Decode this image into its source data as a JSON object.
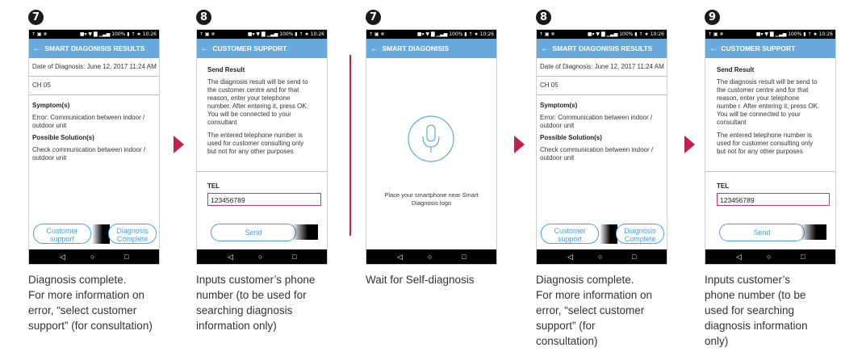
{
  "status": {
    "left": "↑ ▣ ✵",
    "right": "■▾ ▼ ▇ ▁▃▅ 100% ▮ ↑ ★ 10:26"
  },
  "nav": {
    "back": "◁",
    "home": "○",
    "recent": "□"
  },
  "accent": "#c41e4b",
  "screens": [
    {
      "step": "7",
      "title": "SMART DIAGONISIS RESULTS",
      "date": "Date of Diagnosis: June 12, 2017 11:24 AM",
      "code": "CH 05",
      "symptom_heading": "Symptom(s)",
      "symptom_text": "Error: Communication between indoor / outdoor unit",
      "solution_heading": "Possible Solution(s)",
      "solution_text": "Check communication between indoor / outdoor unit",
      "btn_customer_1": "Customer",
      "btn_customer_2": "support",
      "btn_diag_1": "Diagnosis",
      "btn_diag_2": "Complete",
      "caption": [
        "Diagnosis complete.",
        "For more information on",
        "error, “select customer",
        "support” (for consultation)"
      ]
    },
    {
      "step": "8",
      "title": "CUSTOMER SUPPORT",
      "send_heading": "Send Result",
      "p1": [
        "The diagnosis result will be send to",
        "the customer centre and for that",
        "reason, enter your telephone",
        "number. After entering it, press OK.",
        "You will be connected to your",
        "consultant"
      ],
      "p2": [
        "The entered telephone number is",
        "used for customer consulting only",
        "but not for any other purposes"
      ],
      "tel_label": "TEL",
      "tel_value": "123456789",
      "send_button": "Send",
      "caption": [
        "Inputs customer’s phone",
        "number (to be used for",
        "searching diagnosis",
        "information only)"
      ]
    },
    {
      "step": "7",
      "title": "SMART DIAGONISIS",
      "instruction": [
        "Place your smartphone near Smart",
        "Diagnosis logo"
      ],
      "caption": [
        "Wait for Self-diagnosis"
      ]
    },
    {
      "step": "8",
      "title": "SMART DIAGONISIS RESULTS",
      "date": "Date of Diagnosis: June 12, 2017 11:24 AM",
      "code": "CH 05",
      "symptom_heading": "Symptom(s)",
      "symptom_text": "Error: Communication between indoor / outdoor unit",
      "solution_heading": "Possible Solution(s)",
      "solution_text": "Check communication between indoor / outdoor unit",
      "btn_customer_1": "Customer",
      "btn_customer_2": "support",
      "btn_diag_1": "Diagnosis",
      "btn_diag_2": "Complete",
      "caption": [
        "Diagnosis complete.",
        "For more information on",
        "error, “select customer",
        "support” (for",
        "consultation)"
      ]
    },
    {
      "step": "9",
      "title": "CUSTOMER SUPPORT",
      "send_heading": "Send Result",
      "p1": [
        "The diagnosis result will be send to",
        "the customer centre and for that",
        "reason, enter your telephone",
        "numbe r. After entering it, press OK.",
        "You will be connected to your",
        "consultant"
      ],
      "p2": [
        "The entered telephone number is",
        "used for customer consulting only",
        "but not for any other purposes"
      ],
      "tel_label": "TEL",
      "tel_value": "123456789",
      "send_button": "Send",
      "caption": [
        "Inputs customer’s",
        "phone number (to be",
        "used for searching",
        "diagnosis information",
        "only)"
      ]
    }
  ]
}
